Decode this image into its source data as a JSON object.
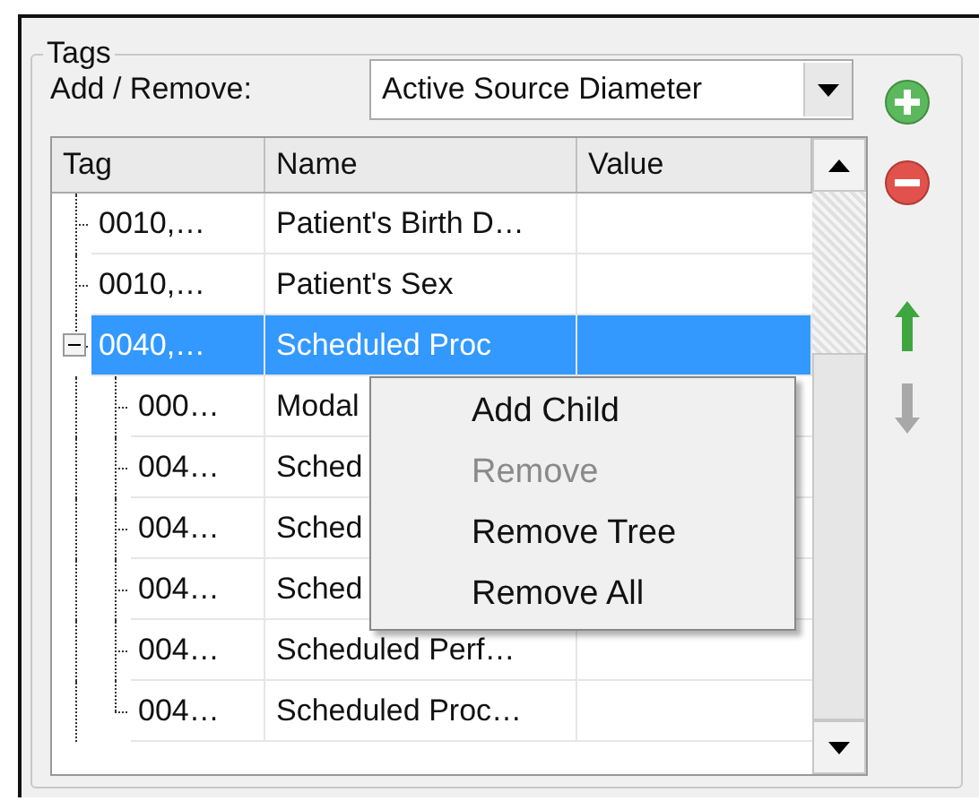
{
  "group": {
    "title": "Tags"
  },
  "add_remove": {
    "label": "Add / Remove:",
    "value": "Active Source Diameter"
  },
  "move_up": {
    "disabled": false
  },
  "move_down": {
    "disabled": true
  },
  "table": {
    "columns": [
      "Tag",
      "Name",
      "Value"
    ],
    "rows": [
      {
        "tag": "0010,…",
        "name": "Patient's Birth D…",
        "selected": false
      },
      {
        "tag": "0010,…",
        "name": "Patient's Sex",
        "selected": false
      },
      {
        "tag": "0040,…",
        "name": "Scheduled Proc",
        "selected": true,
        "expanded": true,
        "children": [
          {
            "tag": "000…",
            "name": "Modal",
            "selected": false
          },
          {
            "tag": "004…",
            "name": "Sched",
            "selected": false
          },
          {
            "tag": "004…",
            "name": "Sched",
            "selected": false
          },
          {
            "tag": "004…",
            "name": "Sched",
            "selected": false
          },
          {
            "tag": "004…",
            "name": "Scheduled Perf…",
            "selected": false
          },
          {
            "tag": "004…",
            "name": "Scheduled Proc…",
            "selected": false
          }
        ]
      }
    ]
  },
  "context_menu": {
    "items": [
      {
        "label": "Add Child",
        "disabled": false
      },
      {
        "label": "Remove",
        "disabled": true
      },
      {
        "label": "Remove Tree",
        "disabled": false
      },
      {
        "label": "Remove All",
        "disabled": false
      }
    ]
  }
}
